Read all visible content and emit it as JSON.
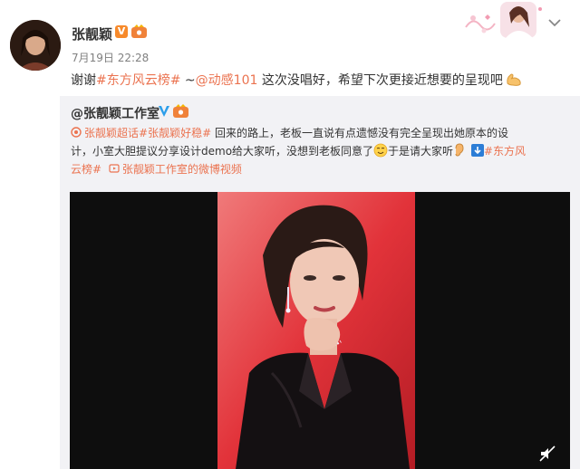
{
  "post": {
    "username": "张靓颖",
    "verified_badge": "V",
    "timestamp": "7月19日 22:28",
    "text_prefix": "谢谢",
    "hashtag": "#东方风云榜#",
    "text_sep": " ~",
    "mention": "@动感101",
    "text_body": " 这次没唱好，希望下次更接近想要的呈现吧",
    "emoji_icon": "flexed-biceps-icon"
  },
  "repost": {
    "username": "@张靓颖工作室",
    "super_topic": "张靓颖超话",
    "hashtag1": "#张靓颖好稳#",
    "line1_text": " 回来的路上，老板一直说有点遗憾没有完全呈现出她原本的设",
    "line2_text": "计，小室大胆提议分享设计demo给大家听，没想到老板同意了",
    "line2_after_emoji": "于是请大家听",
    "hashtag2_part1": "#东方风",
    "hashtag2_part2": "云榜#",
    "video_link": "张靓颖工作室的微博视频"
  },
  "colors": {
    "link": "#eb7350",
    "repost_bg": "#f2f2f5",
    "video_bg": "#0e0e0e",
    "photo_bg": "#e2333a"
  }
}
